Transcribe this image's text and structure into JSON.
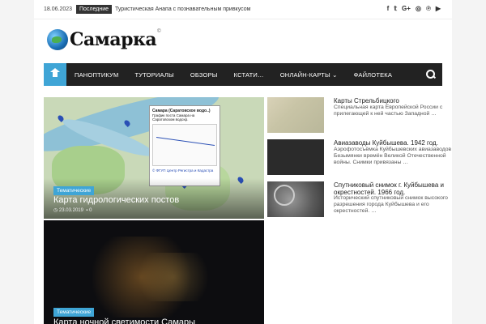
{
  "topbar": {
    "date": "18.06.2023",
    "latest_label": "Последние",
    "ticker": "Туристическая Анапа с познавательным привкусом",
    "social_icons": [
      "facebook-icon",
      "twitter-icon",
      "google-plus-icon",
      "instagram-icon",
      "pinterest-icon",
      "youtube-icon"
    ],
    "social_glyphs": [
      "f",
      "𝕥",
      "G+",
      "◎",
      "℗",
      "▶"
    ]
  },
  "logo": {
    "text": "Самарка",
    "mark": "©"
  },
  "nav": {
    "items": [
      "Паноптикум",
      "Туториалы",
      "Обзоры",
      "Кстати…",
      "Онлайн-карты",
      "Файлотека"
    ],
    "accent": "#3fa5d6"
  },
  "featured": [
    {
      "category": "Тематические",
      "title": "Карта гидрологических постов",
      "date": "23.03.2019",
      "comments": "0",
      "popup": {
        "title": "Самара (Саратовское водо..)",
        "subtitle": "График поста Самара на Саратовском водохр.",
        "footer": "© ФГУП Центр Регистра и Кадастра"
      }
    },
    {
      "category": "Тематические",
      "title": "Карта ночной светимости Самары"
    }
  ],
  "side_posts": [
    {
      "title": "Карты Стрельбицкого",
      "excerpt": "Специальная карта Европейской России с прилегающей к ней частью Западной …"
    },
    {
      "title": "Авиазаводы Куйбышева. 1942 год.",
      "excerpt": "Аэрофотосъёмка Куйбышевских авиазаводов Безымянки времён Великой Отечественной войны. Снимки привязаны …"
    },
    {
      "title": "Спутниковый снимок г. Куйбышева и окрестностей. 1966 год.",
      "excerpt": "Исторический спутниковый снимок высокого разрешения города Куйбышева и его окрестностей. …"
    }
  ]
}
